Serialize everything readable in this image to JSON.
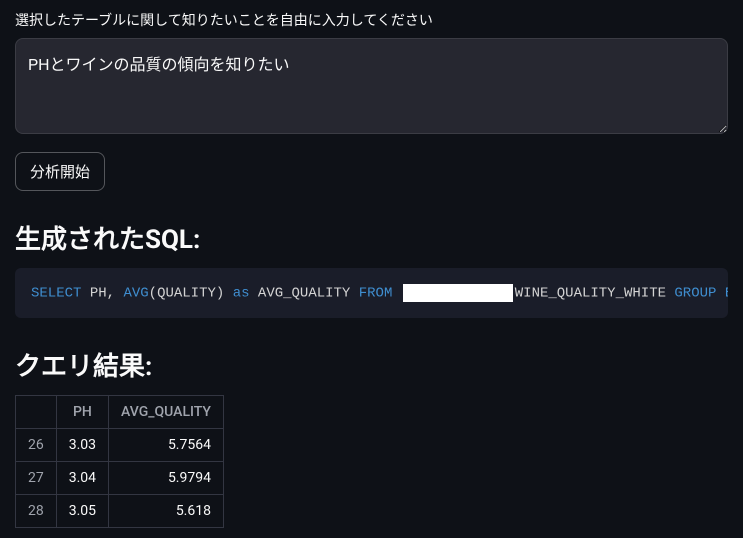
{
  "input": {
    "label": "選択したテーブルに関して知りたいことを自由に入力してください",
    "value": "PHとワインの品質の傾向を知りたい",
    "button": "分析開始"
  },
  "sql": {
    "heading": "生成されたSQL:",
    "tokens": {
      "select": "SELECT",
      "ph": "PH,",
      "avg": "AVG",
      "quality_open": "(QUALITY)",
      "as": "as",
      "avg_quality": "AVG_QUALITY",
      "from": "FROM",
      "table_suffix": "WINE_QUALITY_WHITE",
      "group_by": "GROUP BY"
    }
  },
  "results": {
    "heading": "クエリ結果:",
    "columns": [
      "PH",
      "AVG_QUALITY"
    ],
    "rows": [
      {
        "idx": "26",
        "ph": "3.03",
        "avg": "5.7564"
      },
      {
        "idx": "27",
        "ph": "3.04",
        "avg": "5.9794"
      },
      {
        "idx": "28",
        "ph": "3.05",
        "avg": "5.618"
      }
    ]
  }
}
